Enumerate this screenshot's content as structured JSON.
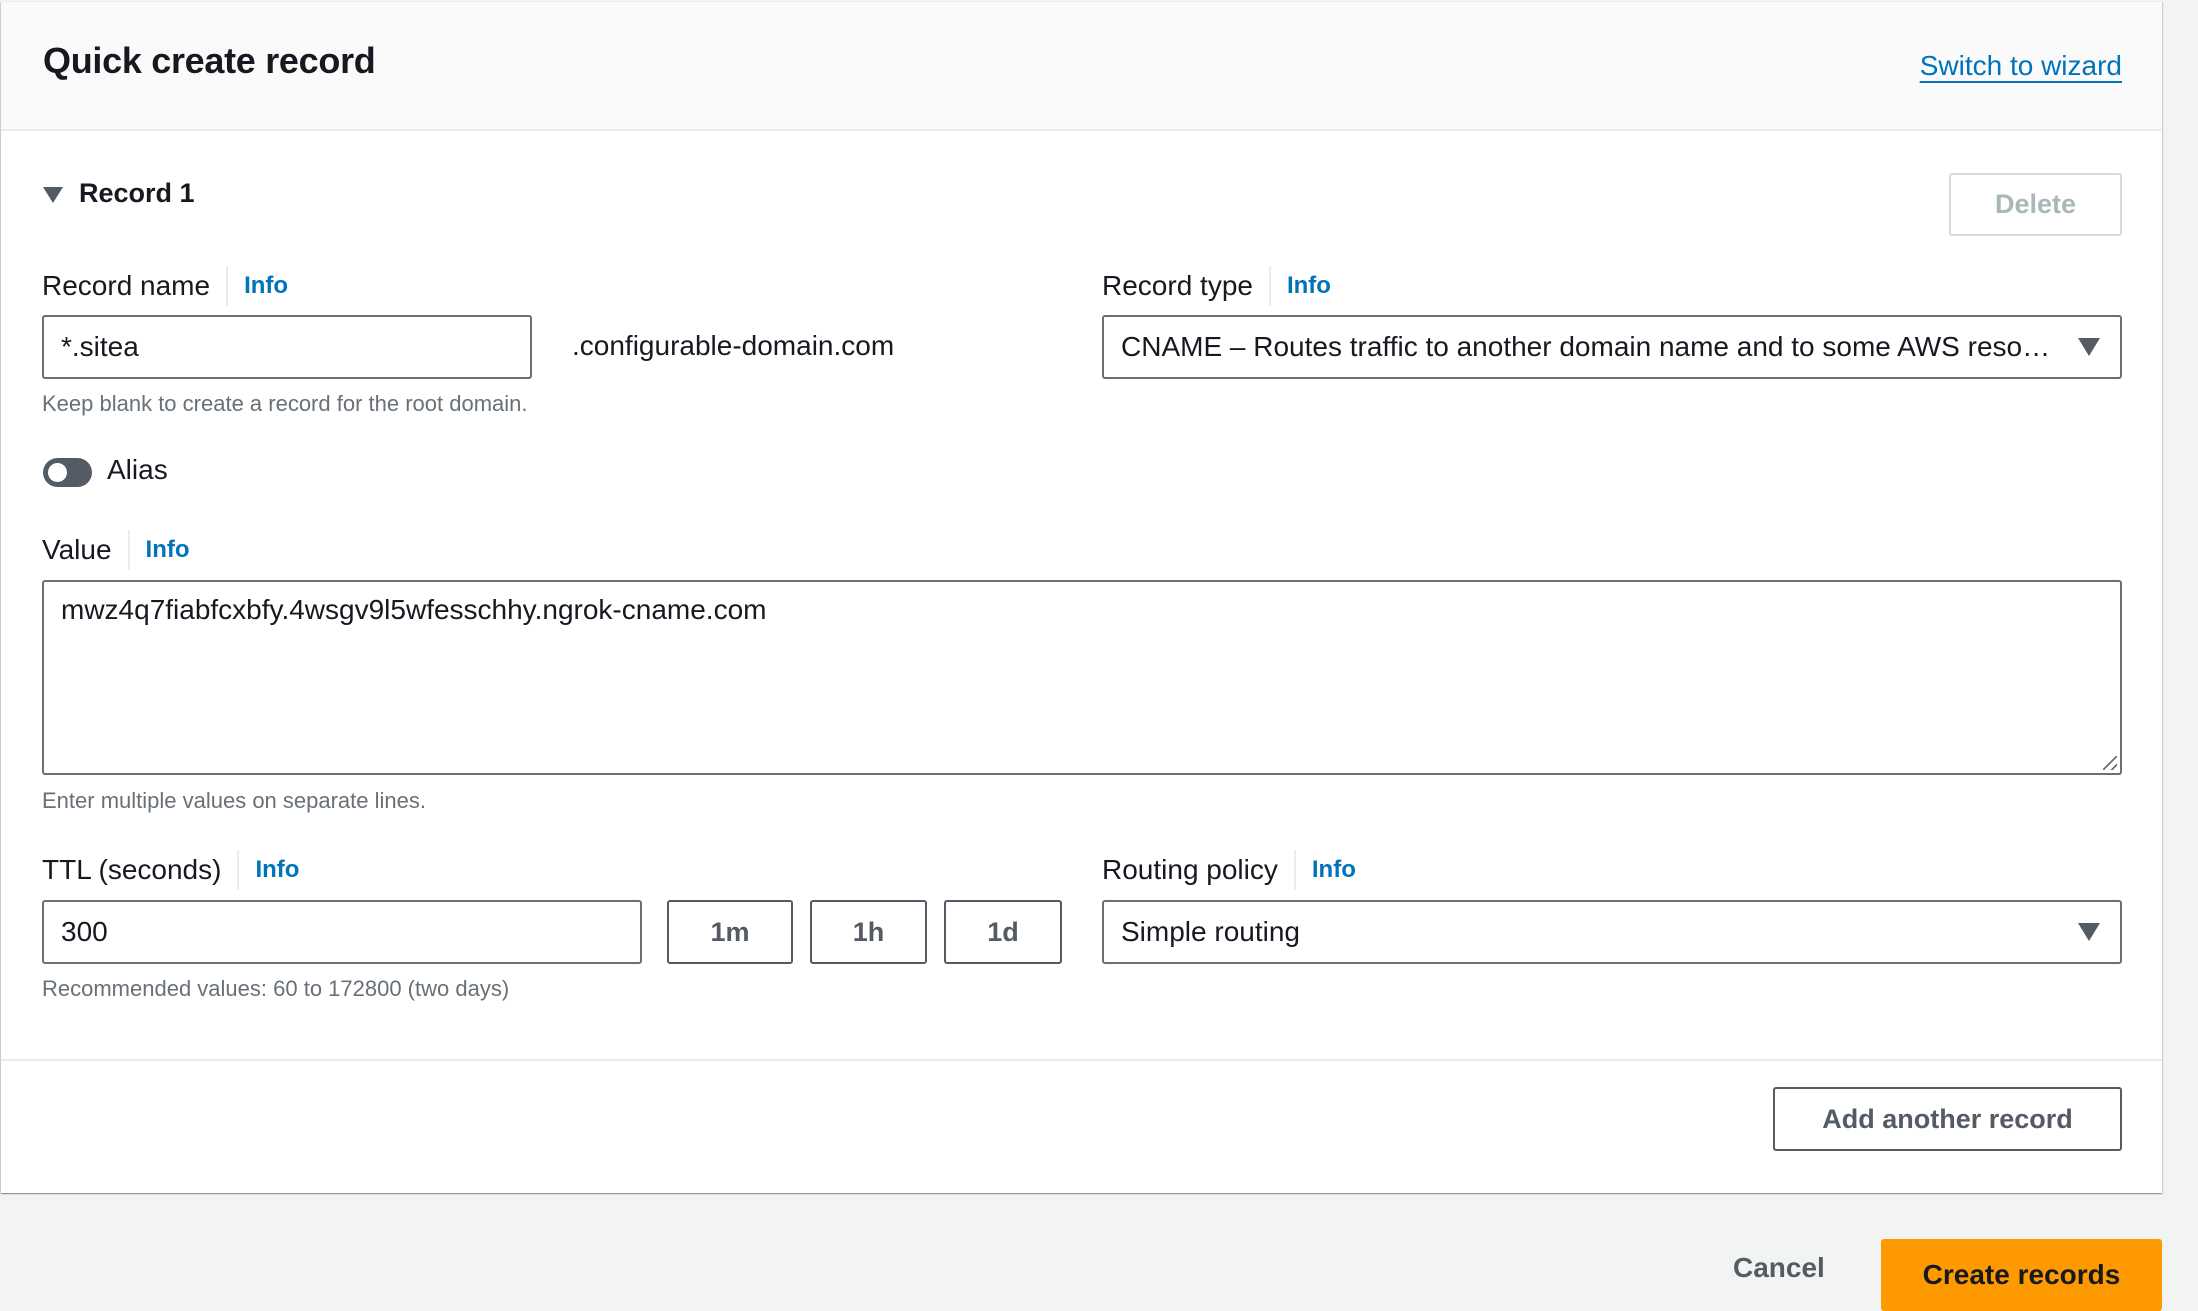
{
  "header": {
    "title": "Quick create record",
    "switch_link": "Switch to wizard"
  },
  "record": {
    "section_title": "Record 1",
    "delete_label": "Delete",
    "record_name": {
      "label": "Record name",
      "info": "Info",
      "value": "*.sitea",
      "suffix": ".configurable-domain.com",
      "hint": "Keep blank to create a record for the root domain."
    },
    "record_type": {
      "label": "Record type",
      "info": "Info",
      "selected": "CNAME – Routes traffic to another domain name and to some AWS resources"
    },
    "alias": {
      "label": "Alias",
      "enabled": false
    },
    "value": {
      "label": "Value",
      "info": "Info",
      "text": "mwz4q7fiabfcxbfy.4wsgv9l5wfesschhy.ngrok-cname.com",
      "hint": "Enter multiple values on separate lines."
    },
    "ttl": {
      "label": "TTL (seconds)",
      "info": "Info",
      "value": "300",
      "presets": [
        "1m",
        "1h",
        "1d"
      ],
      "hint": "Recommended values: 60 to 172800 (two days)"
    },
    "routing_policy": {
      "label": "Routing policy",
      "info": "Info",
      "selected": "Simple routing"
    }
  },
  "footer": {
    "add_another": "Add another record",
    "cancel": "Cancel",
    "create": "Create records"
  },
  "colors": {
    "link": "#0073bb",
    "primary": "#ff9900",
    "background": "#f2f3f3"
  }
}
